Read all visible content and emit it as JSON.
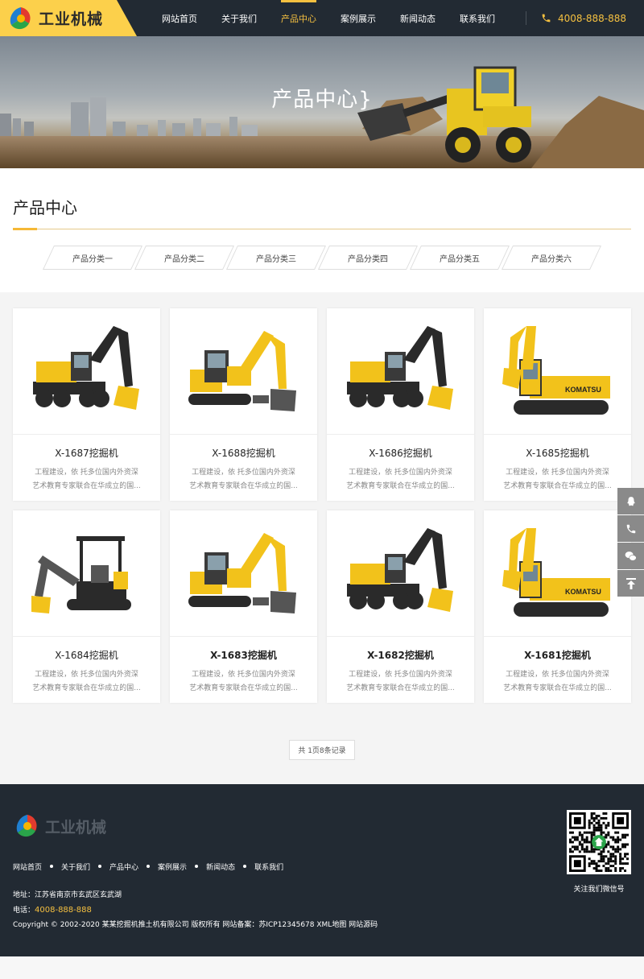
{
  "brand": {
    "name": "工业机械"
  },
  "nav": [
    {
      "label": "网站首页",
      "active": false
    },
    {
      "label": "关于我们",
      "active": false
    },
    {
      "label": "产品中心",
      "active": true
    },
    {
      "label": "案例展示",
      "active": false
    },
    {
      "label": "新闻动态",
      "active": false
    },
    {
      "label": "联系我们",
      "active": false
    }
  ],
  "phone": "4008-888-888",
  "banner": {
    "title": "产品中心}"
  },
  "section": {
    "title": "产品中心"
  },
  "categories": [
    "产品分类一",
    "产品分类二",
    "产品分类三",
    "产品分类四",
    "产品分类五",
    "产品分类六"
  ],
  "products": [
    {
      "title": "X-1687挖掘机",
      "desc1": "工程建设，依 托多位国内外资深",
      "desc2": "艺术教育专家联合在华成立的国...",
      "img": "wheel-excavator",
      "bold": false
    },
    {
      "title": "X-1688挖掘机",
      "desc1": "工程建设，依 托多位国内外资深",
      "desc2": "艺术教育专家联合在华成立的国...",
      "img": "mini-excavator-yellow",
      "bold": false
    },
    {
      "title": "X-1686挖掘机",
      "desc1": "工程建设，依 托多位国内外资深",
      "desc2": "艺术教育专家联合在华成立的国...",
      "img": "wheel-excavator",
      "bold": false
    },
    {
      "title": "X-1685挖掘机",
      "desc1": "工程建设，依 托多位国内外资深",
      "desc2": "艺术教育专家联合在华成立的国...",
      "img": "komatsu-excavator",
      "bold": false
    },
    {
      "title": "X-1684挖掘机",
      "desc1": "工程建设，依 托多位国内外资深",
      "desc2": "艺术教育专家联合在华成立的国...",
      "img": "compact-excavator",
      "bold": false
    },
    {
      "title": "X-1683挖掘机",
      "desc1": "工程建设，依 托多位国内外资深",
      "desc2": "艺术教育专家联合在华成立的国...",
      "img": "mini-excavator-yellow",
      "bold": true
    },
    {
      "title": "X-1682挖掘机",
      "desc1": "工程建设，依 托多位国内外资深",
      "desc2": "艺术教育专家联合在华成立的国...",
      "img": "wheel-excavator",
      "bold": true
    },
    {
      "title": "X-1681挖掘机",
      "desc1": "工程建设，依 托多位国内外资深",
      "desc2": "艺术教育专家联合在华成立的国...",
      "img": "komatsu-excavator",
      "bold": true
    }
  ],
  "pager": "共 1页8条记录",
  "side_tools": [
    "qq-icon",
    "phone-icon",
    "wechat-icon",
    "back-to-top-icon"
  ],
  "footer": {
    "brand": "工业机械",
    "nav": [
      "网站首页",
      "关于我们",
      "产品中心",
      "案例展示",
      "新闻动态",
      "联系我们"
    ],
    "address": "地址：江苏省南京市玄武区玄武湖",
    "tel_label": "电话：",
    "tel": "4008-888-888",
    "copyright": "Copyright © 2002-2020 某某挖掘机推土机有限公司 版权所有 网站备案：苏ICP12345678 XML地图 网站源码",
    "qr_label": "关注我们微信号"
  },
  "colors": {
    "accent": "#f5c040",
    "dark": "#222a33",
    "logo_bg": "#fcd04b"
  }
}
